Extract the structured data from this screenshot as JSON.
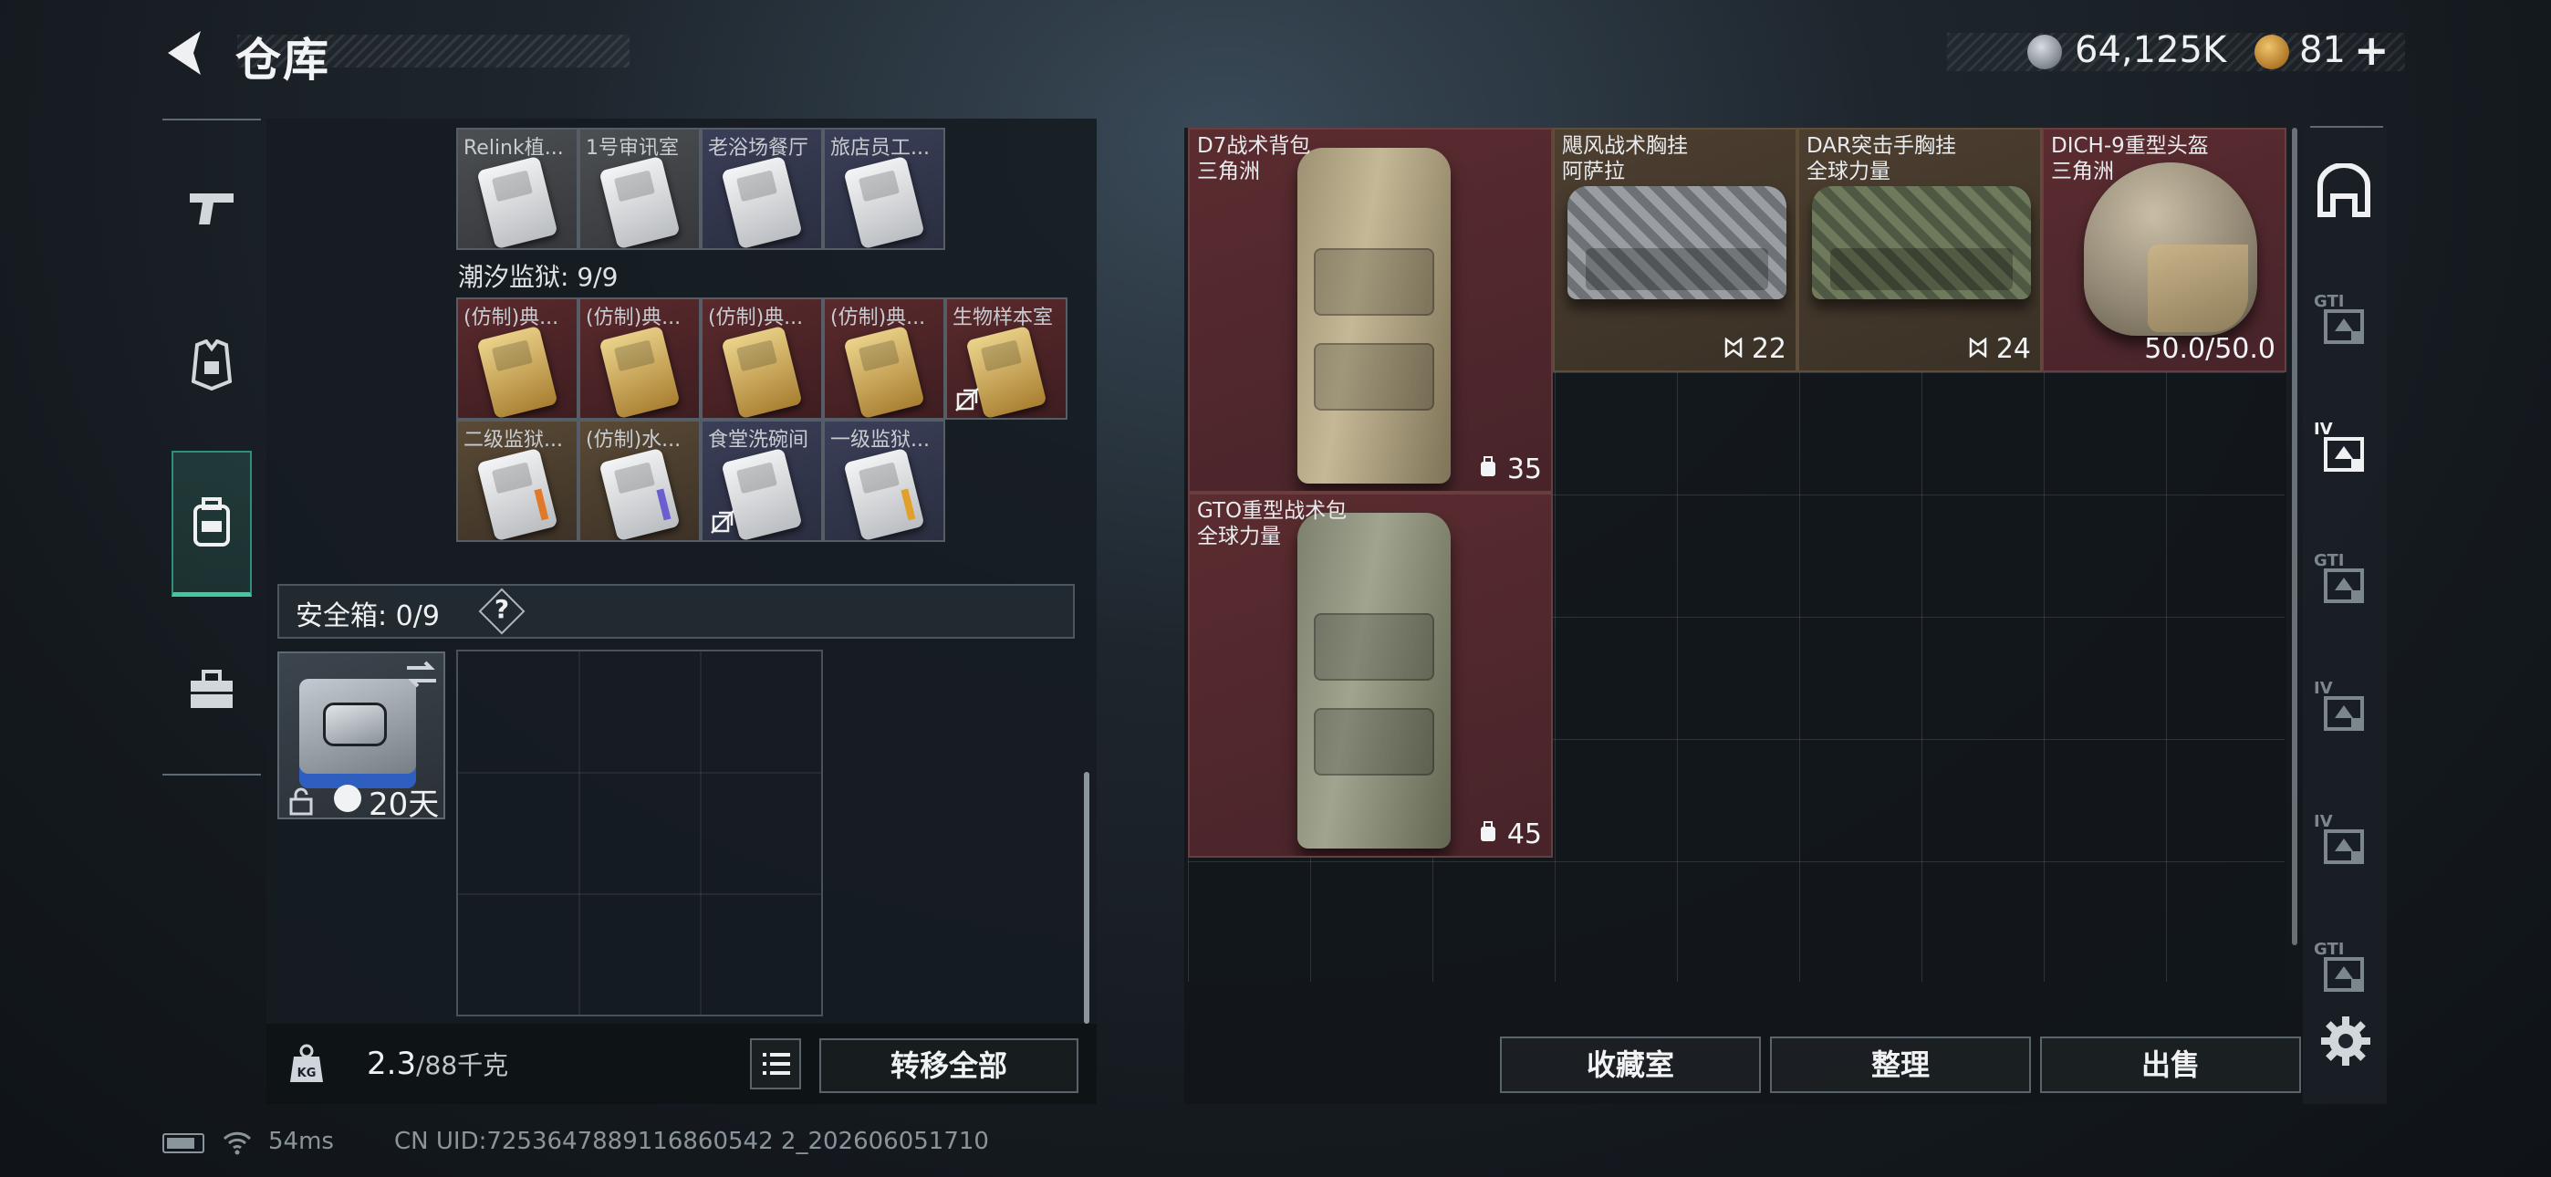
{
  "header": {
    "title": "仓库",
    "currency_silver": "64,125K",
    "currency_gold": "81",
    "plus": "+"
  },
  "left_nav": [
    {
      "icon": "pistol-icon"
    },
    {
      "icon": "armor-icon"
    },
    {
      "icon": "backpack-icon",
      "active": true
    },
    {
      "icon": "toolbox-icon"
    }
  ],
  "keycards_row1": [
    {
      "label": "Relink植...",
      "color": "gray"
    },
    {
      "label": "1号审讯室",
      "color": "gray"
    },
    {
      "label": "老浴场餐厅",
      "color": "blue"
    },
    {
      "label": "旅店员工...",
      "color": "blue"
    }
  ],
  "section_title": "潮汐监狱: 9/9",
  "keycards_row2": [
    {
      "label": "(仿制)典...",
      "color": "red",
      "card": "gold"
    },
    {
      "label": "(仿制)典...",
      "color": "red",
      "card": "gold"
    },
    {
      "label": "(仿制)典...",
      "color": "red",
      "card": "gold"
    },
    {
      "label": "(仿制)典...",
      "color": "red",
      "card": "gold"
    },
    {
      "label": "生物样本室",
      "color": "red",
      "card": "gold",
      "no_link": true
    }
  ],
  "keycards_row3": [
    {
      "label": "二级监狱...",
      "color": "brown",
      "card": "white",
      "stripe": "#e07a2a"
    },
    {
      "label": "(仿制)水...",
      "color": "brown",
      "card": "white",
      "stripe": "#6b5fd0"
    },
    {
      "label": "食堂洗碗间",
      "color": "blue",
      "card": "white",
      "no_link": true
    },
    {
      "label": "一级监狱...",
      "color": "blue",
      "card": "white",
      "stripe": "#e0a02a"
    }
  ],
  "safe": {
    "label": "安全箱: 0/9",
    "help": "?",
    "timer": "20天"
  },
  "weight": {
    "current": "2.3",
    "capacity": "/88千克"
  },
  "transfer_all": "转移全部",
  "items": [
    {
      "name": "D7战术背包",
      "origin": "三角洲",
      "value": "35",
      "value_icon": "capacity-icon"
    },
    {
      "name": "飓风战术胸挂",
      "origin": "阿萨拉",
      "value": "22",
      "value_icon": "slots-icon"
    },
    {
      "name": "DAR突击手胸挂",
      "origin": "全球力量",
      "value": "24",
      "value_icon": "slots-icon"
    },
    {
      "name": "DICH-9重型头盔",
      "origin": "三角洲",
      "value": "50.0/50.0"
    },
    {
      "name": "GTO重型战术包",
      "origin": "全球力量",
      "value": "45",
      "value_icon": "capacity-icon"
    }
  ],
  "right_sidebar": [
    {
      "icon": "garage-icon",
      "label": ""
    },
    {
      "icon": "helmet-rack-icon",
      "label": "GTI"
    },
    {
      "icon": "armor-rack-icon",
      "label": "IV"
    },
    {
      "icon": "weapon-rack-icon",
      "label": "GTI"
    },
    {
      "icon": "medical-rack-icon",
      "label": "IV"
    },
    {
      "icon": "ammo-rack-icon",
      "label": "IV"
    },
    {
      "icon": "rifle-rack-icon",
      "label": "GTI"
    }
  ],
  "actions": {
    "collection": "收藏室",
    "organize": "整理",
    "sell": "出售"
  },
  "footer": {
    "ping": "54ms",
    "uid": "CN UID:7253647889116860542 2_202606051710"
  }
}
